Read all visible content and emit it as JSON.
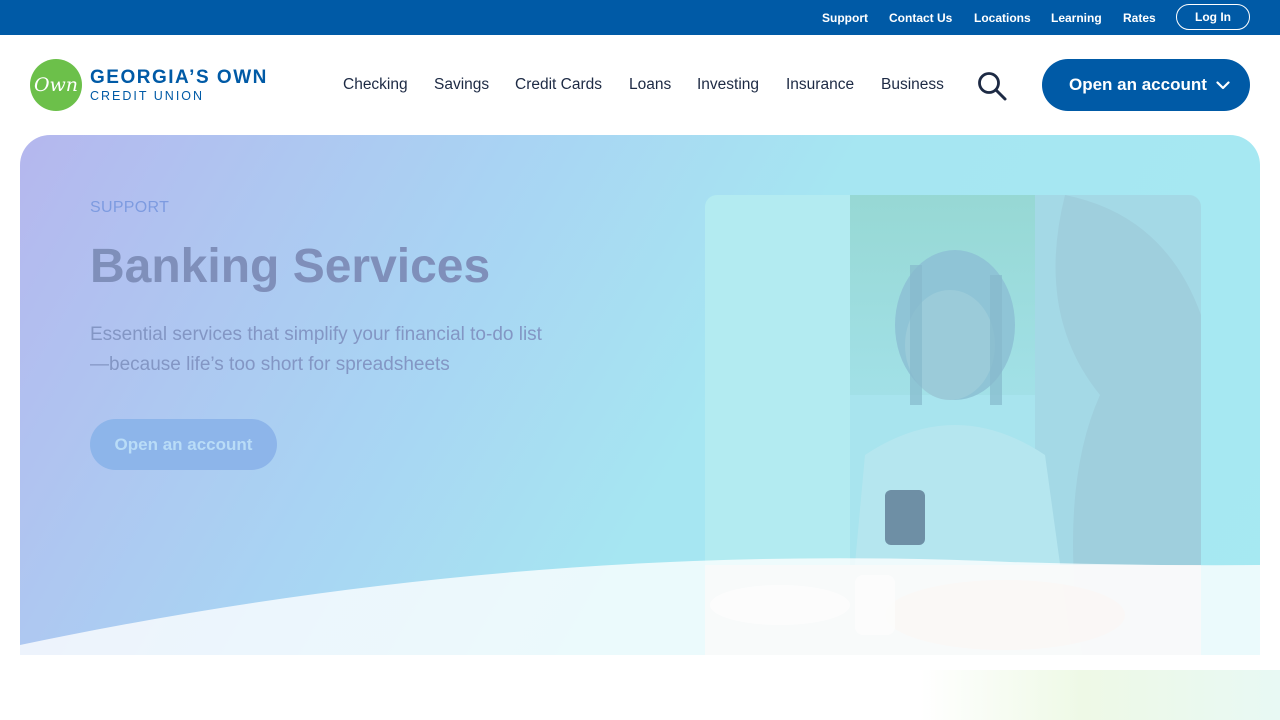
{
  "utility_nav": {
    "links": [
      "Support",
      "Contact Us",
      "Locations",
      "Learning",
      "Rates"
    ],
    "login_label": "Log In"
  },
  "brand": {
    "logo_mark": "Own",
    "name_line1": "GEORGIA’S OWN",
    "name_line2": "CREDIT UNION",
    "colors": {
      "primary": "#005aa6",
      "logo_green": "#6cc04a",
      "nav_text": "#1d2a44"
    }
  },
  "main_nav": {
    "items": [
      "Checking",
      "Savings",
      "Credit Cards",
      "Loans",
      "Investing",
      "Insurance",
      "Business"
    ],
    "search_icon": "search-icon",
    "cta_label": "Open an account",
    "cta_icon": "chevron-down-icon"
  },
  "hero": {
    "eyebrow": "SUPPORT",
    "title": "Banking Services",
    "subtitle": "Essential services that simplify your financial to-do list—because life’s too short for spreadsheets",
    "button_label": "Open an account",
    "image": "woman-paying-with-card-reader-photo"
  }
}
